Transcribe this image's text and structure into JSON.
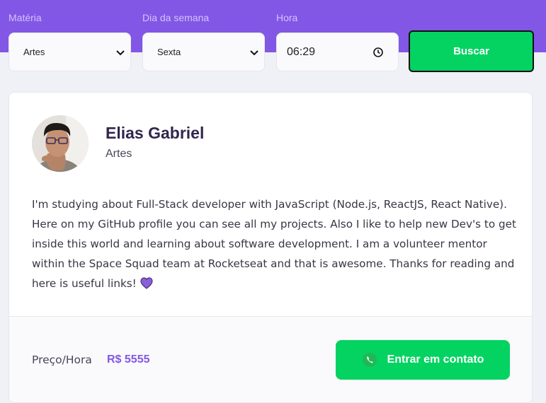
{
  "filters": {
    "subject": {
      "label": "Matéria",
      "value": "Artes"
    },
    "weekday": {
      "label": "Dia da semana",
      "value": "Sexta"
    },
    "time": {
      "label": "Hora",
      "value": "06:29"
    },
    "search_label": "Buscar"
  },
  "teacher": {
    "name": "Elias Gabriel",
    "subject": "Artes",
    "bio": "I'm studying about Full-Stack developer with JavaScript (Node.js, ReactJS, React Native). Here on my GitHub profile you can see all my projects. Also I like to help new Dev's to get inside this world and learning about software development. I am a volunteer mentor within the Space Squad team at Rocketseat and that is awesome. Thanks for reading and here is useful links!",
    "price_label": "Preço/Hora",
    "price_value": "R$ 5555",
    "contact_label": "Entrar em contato"
  },
  "colors": {
    "primary": "#8257e5",
    "secondary": "#04d361",
    "background": "#f0f0f7",
    "title": "#32264d"
  },
  "icons": {
    "select_arrow": "chevron-down-icon",
    "time": "clock-icon",
    "emoji": "purple-heart-icon",
    "contact": "whatsapp-icon"
  }
}
